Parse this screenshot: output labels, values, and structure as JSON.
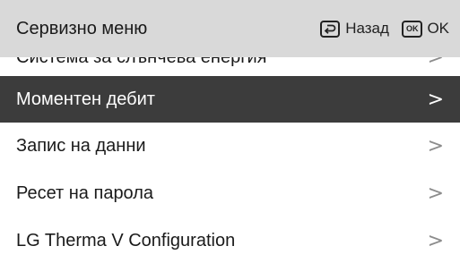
{
  "header": {
    "title": "Сервизно меню",
    "back_label": "Назад",
    "ok_icon_text": "OK",
    "ok_label": "OK",
    "back_icon": "return-arrow-icon"
  },
  "menu": {
    "selected_index": 1,
    "items": [
      {
        "label": "Система за слънчева енергия",
        "chevron": ">"
      },
      {
        "label": "Моментен дебит",
        "chevron": ">"
      },
      {
        "label": "Запис на данни",
        "chevron": ">"
      },
      {
        "label": "Ресет на парола",
        "chevron": ">"
      },
      {
        "label": "LG Therma V Configuration",
        "chevron": ">"
      }
    ]
  },
  "colors": {
    "header_bg": "#d9d9d9",
    "selected_bg": "#3c3c3c",
    "chevron": "#8c8c8c"
  }
}
